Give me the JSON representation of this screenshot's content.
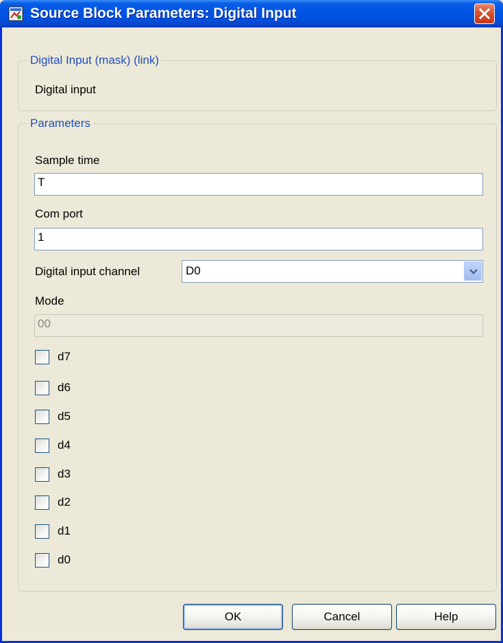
{
  "window": {
    "title": "Source Block Parameters: Digital Input"
  },
  "description_group": {
    "legend": "Digital Input (mask) (link)",
    "text": "Digital input"
  },
  "parameters_group": {
    "legend": "Parameters",
    "sample_time": {
      "label": "Sample time",
      "value": "T"
    },
    "com_port": {
      "label": "Com port",
      "value": "1"
    },
    "digital_input_channel": {
      "label": "Digital input channel",
      "value": "D0"
    },
    "mode": {
      "label": "Mode",
      "value": "00"
    },
    "checkboxes": [
      {
        "label": "d7",
        "checked": false
      },
      {
        "label": "d6",
        "checked": false
      },
      {
        "label": "d5",
        "checked": false
      },
      {
        "label": "d4",
        "checked": false
      },
      {
        "label": "d3",
        "checked": false
      },
      {
        "label": "d2",
        "checked": false
      },
      {
        "label": "d1",
        "checked": false
      },
      {
        "label": "d0",
        "checked": false
      }
    ]
  },
  "buttons": {
    "ok": "OK",
    "cancel": "Cancel",
    "help": "Help"
  },
  "colors": {
    "titlebar": "#0054e3",
    "accent_text": "#1f4fbf",
    "close": "#d9512d"
  },
  "icons": {
    "app": "simulink-block-icon",
    "close": "close-icon",
    "dropdown": "chevron-down-icon"
  }
}
